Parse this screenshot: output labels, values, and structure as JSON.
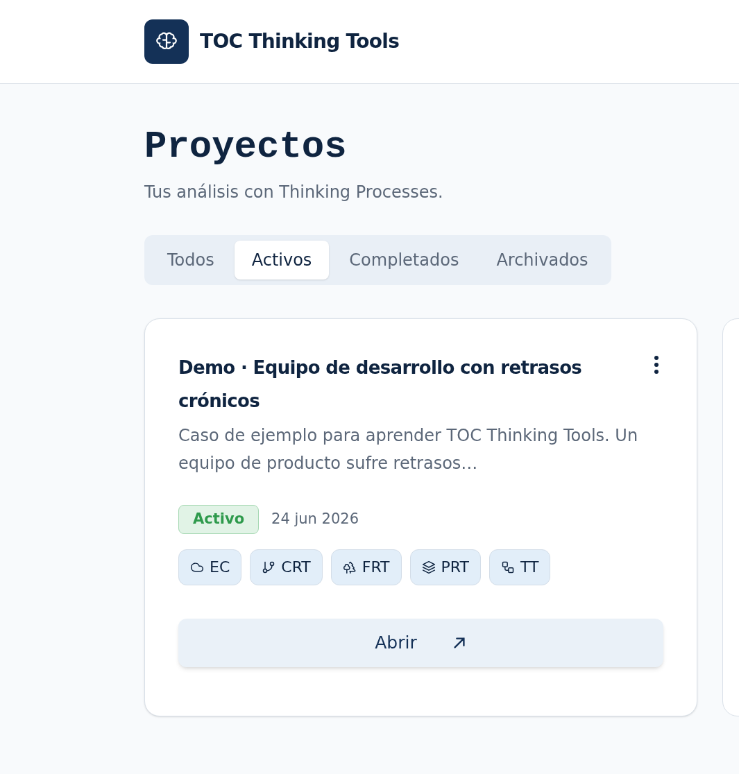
{
  "app": {
    "title": "TOC Thinking Tools"
  },
  "page": {
    "title": "Proyectos",
    "subtitle": "Tus análisis con Thinking Processes."
  },
  "tabs": [
    {
      "label": "Todos",
      "selected": false
    },
    {
      "label": "Activos",
      "selected": true
    },
    {
      "label": "Completados",
      "selected": false
    },
    {
      "label": "Archivados",
      "selected": false
    }
  ],
  "projects": [
    {
      "title": "Demo · Equipo de desarrollo con retrasos crónicos",
      "description": "Caso de ejemplo para aprender TOC Thinking Tools. Un equipo de producto sufre retrasos…",
      "status": "Activo",
      "date": "24 jun 2026",
      "tools": [
        {
          "label": "EC",
          "kind": "cloud"
        },
        {
          "label": "CRT",
          "kind": "branch"
        },
        {
          "label": "FRT",
          "kind": "trees"
        },
        {
          "label": "PRT",
          "kind": "layers"
        },
        {
          "label": "TT",
          "kind": "boxes"
        }
      ],
      "action": "Abrir"
    }
  ]
}
